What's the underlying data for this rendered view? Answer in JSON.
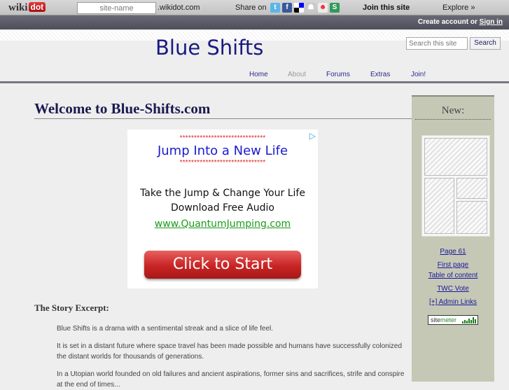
{
  "wikidot_bar": {
    "logo_text": "wiki",
    "logo_badge": "dot",
    "site_input_value": "site-name",
    "domain_suffix": ".wikidot.com",
    "share_label": "Share on",
    "share_icons": [
      "twitter-icon",
      "facebook-icon",
      "delicious-icon",
      "digg-icon",
      "reddit-icon",
      "stumbleupon-icon"
    ],
    "join_label": "Join this site",
    "explore_label": "Explore »",
    "create_account_label": "Create account or",
    "sign_in_label": "Sign in"
  },
  "header": {
    "site_title": "Blue Shifts",
    "search_placeholder": "Search this site",
    "search_button": "Search",
    "nav": [
      {
        "label": "Home",
        "active": true
      },
      {
        "label": "About",
        "active": false
      },
      {
        "label": "Forums",
        "active": true
      },
      {
        "label": "Extras",
        "active": true
      },
      {
        "label": "Join!",
        "active": true
      }
    ]
  },
  "main": {
    "page_title": "Welcome to Blue-Shifts.com",
    "ad": {
      "stars": "******************************",
      "headline": "Jump Into a New Life",
      "line1": "Take the Jump & Change Your Life",
      "line2": "Download Free Audio",
      "url": "www.QuantumJumping.com",
      "cta": "Click to Start"
    },
    "section_title": "The Story Excerpt:",
    "paragraphs": [
      "Blue Shifts is a drama with a sentimental streak and a slice of life feel.",
      "It is set in a distant future where space travel has been made possible and humans have successfully colonized the distant worlds for thousands of generations.",
      "In a Utopian world founded on old failures and ancient aspirations, former sins and sacrifices, strife and conspire at the end of times..."
    ]
  },
  "sidebar": {
    "heading": "New:",
    "links": [
      "Page 61",
      "First page",
      "Table of content",
      "TWC Vote",
      "[+] Admin Links"
    ],
    "sitemeter_a": "site",
    "sitemeter_b": "meter"
  },
  "colors": {
    "title_blue": "#1a1a80",
    "nav_blue": "#2a2a90",
    "sidebar_bg": "#c6c8b6",
    "ad_red": "#c82424"
  }
}
